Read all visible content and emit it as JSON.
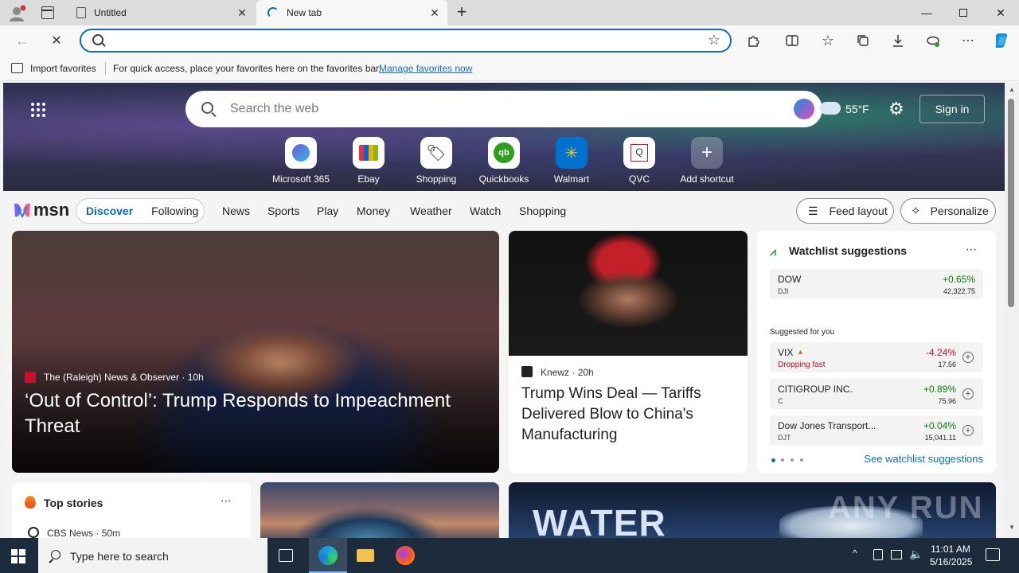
{
  "tabs": [
    {
      "title": "Untitled",
      "icon": "page-icon"
    },
    {
      "title": "New tab",
      "icon": "loading-icon"
    }
  ],
  "toolbar": {
    "address_value": "",
    "icons": [
      "back-icon",
      "stop-icon",
      "search-icon",
      "favorite-star-icon",
      "extensions-icon",
      "split-screen-icon",
      "favorites-icon",
      "collections-icon",
      "downloads-icon",
      "browser-essentials-icon",
      "more-icon",
      "copilot-icon"
    ]
  },
  "favbar": {
    "import_label": "Import favorites",
    "message": "For quick access, place your favorites here on the favorites bar.",
    "manage_link": "Manage favorites now"
  },
  "newtab": {
    "search_placeholder": "Search the web",
    "weather": "55°F",
    "sign_in": "Sign in",
    "shortcuts": [
      {
        "label": "Microsoft 365",
        "color": "#6b5bd8"
      },
      {
        "label": "Ebay",
        "color": "#e53238"
      },
      {
        "label": "Shopping",
        "color": "#222222"
      },
      {
        "label": "Quickbooks",
        "color": "#2ca01c"
      },
      {
        "label": "Walmart",
        "color": "#0071ce"
      },
      {
        "label": "QVC",
        "color": "#c8102e"
      },
      {
        "label": "Add shortcut",
        "color": "#ffffff"
      }
    ]
  },
  "msn": {
    "logo": "msn",
    "tabs": [
      "Discover",
      "Following"
    ],
    "nav": [
      "News",
      "Sports",
      "Play",
      "Money",
      "Weather",
      "Watch",
      "Shopping"
    ],
    "feed_layout": "Feed layout",
    "personalize": "Personalize"
  },
  "hero_story": {
    "source": "The (Raleigh) News & Observer",
    "age": "10h",
    "headline": "‘Out of Control’: Trump Responds to Impeachment Threat"
  },
  "second_story": {
    "source": "Knewz",
    "age": "20h",
    "headline": "Trump Wins Deal — Tariffs Delivered Blow to China's Manufacturing"
  },
  "watchlist": {
    "title": "Watchlist suggestions",
    "main": {
      "name": "DOW",
      "ticker": "DJI",
      "change": "+0.65%",
      "value": "42,322.75"
    },
    "suggested_label": "Suggested for you",
    "items": [
      {
        "name": "VIX",
        "sub": "Dropping fast",
        "change": "-4.24%",
        "value": "17.56",
        "negative": true
      },
      {
        "name": "CITIGROUP INC.",
        "sub": "C",
        "change": "+0.89%",
        "value": "75.96",
        "negative": false
      },
      {
        "name": "Dow Jones Transport...",
        "sub": "DJT",
        "change": "+0.04%",
        "value": "15,041.11",
        "negative": false
      }
    ],
    "see_more": "See watchlist suggestions"
  },
  "top_stories": {
    "title": "Top stories",
    "first_source": "CBS News",
    "first_age": "50m"
  },
  "water_card": {
    "text": "WATER"
  },
  "watermark": "ANY RUN",
  "taskbar": {
    "search_placeholder": "Type here to search",
    "time": "11:01 AM",
    "date": "5/16/2025"
  }
}
